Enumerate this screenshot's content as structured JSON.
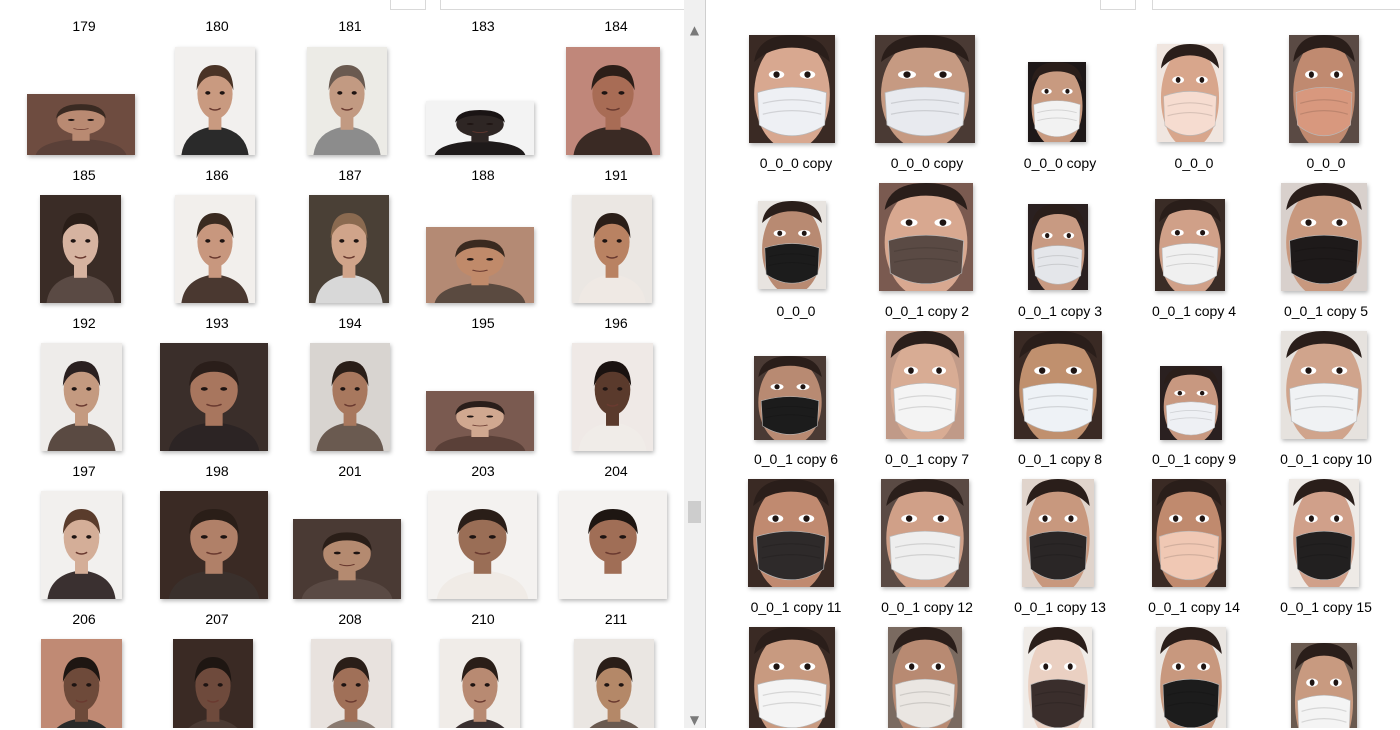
{
  "left_pane": {
    "top_labels": [
      "179",
      "180",
      "181",
      "183",
      "184"
    ],
    "items": [
      {
        "label": "185",
        "bg": "#6e4c40",
        "skin": "#b98a72",
        "hair": "#3a2a22",
        "shirt": "#5a4038"
      },
      {
        "label": "186",
        "bg": "#f2f0ee",
        "skin": "#c99a80",
        "hair": "#4a3326",
        "shirt": "#2a2a2a"
      },
      {
        "label": "187",
        "bg": "#ecebe6",
        "skin": "#c29a82",
        "hair": "#6a5a50",
        "shirt": "#8c8c8c"
      },
      {
        "label": "188",
        "bg": "#f3f3f3",
        "skin": "#2e2624",
        "hair": "#1a1414",
        "shirt": "#1e1a1a"
      },
      {
        "label": "191",
        "bg": "#c0877a",
        "skin": "#a86c55",
        "hair": "#2c1e18",
        "shirt": "#3a2a24"
      },
      {
        "label": "192",
        "bg": "#3a2c26",
        "skin": "#d6b3a0",
        "hair": "#2a1e18",
        "shirt": "#5a4a44"
      },
      {
        "label": "193",
        "bg": "#f2efec",
        "skin": "#c8977e",
        "hair": "#3a2a20",
        "shirt": "#4a3830"
      },
      {
        "label": "194",
        "bg": "#4a4036",
        "skin": "#d0a48a",
        "hair": "#8a6a50",
        "shirt": "#d8d8d8"
      },
      {
        "label": "195",
        "bg": "#b48a74",
        "skin": "#c08a6a",
        "hair": "#3a2a20",
        "shirt": "#5a4a40"
      },
      {
        "label": "196",
        "bg": "#ebe7e3",
        "skin": "#b98262",
        "hair": "#2a1e18",
        "shirt": "#efe9e4"
      },
      {
        "label": "197",
        "bg": "#eeecea",
        "skin": "#c49a80",
        "hair": "#2a2020",
        "shirt": "#5a4a42"
      },
      {
        "label": "198",
        "bg": "#3a2e2a",
        "skin": "#a8765e",
        "hair": "#2a1e1a",
        "shirt": "#2c2424"
      },
      {
        "label": "201",
        "bg": "#d8d4d0",
        "skin": "#a8785e",
        "hair": "#2a1e18",
        "shirt": "#6a5a50"
      },
      {
        "label": "203",
        "bg": "#7a5a50",
        "skin": "#d0a890",
        "hair": "#2a1e1a",
        "shirt": "#5a4038"
      },
      {
        "label": "204",
        "bg": "#efe9e6",
        "skin": "#5a3a2c",
        "hair": "#1a1210",
        "shirt": "#f0ece8"
      },
      {
        "label": "206",
        "bg": "#f2f0ee",
        "skin": "#d4ae98",
        "hair": "#5a3c2c",
        "shirt": "#3a3030"
      },
      {
        "label": "207",
        "bg": "#3a2a24",
        "skin": "#b08068",
        "hair": "#2a1e18",
        "shirt": "#3a302c"
      },
      {
        "label": "208",
        "bg": "#4a3a34",
        "skin": "#b48a70",
        "hair": "#2a1e18",
        "shirt": "#5a4a44"
      },
      {
        "label": "210",
        "bg": "#f4f2f0",
        "skin": "#9a6e56",
        "hair": "#2a1e18",
        "shirt": "#f0ebe6"
      },
      {
        "label": "211",
        "bg": "#f4f2f0",
        "skin": "#a06e56",
        "hair": "#1e1612",
        "shirt": "#f4f2f0"
      },
      {
        "label": "",
        "bg": "#c08a74",
        "skin": "#6e4a3a",
        "hair": "#1e1612",
        "shirt": "#2a2a2a"
      },
      {
        "label": "",
        "bg": "#3a2a24",
        "skin": "#6e4a3c",
        "hair": "#1e1612",
        "shirt": "#4a3a34"
      },
      {
        "label": "",
        "bg": "#e8e2de",
        "skin": "#a07058",
        "hair": "#2a1e18",
        "shirt": "#8a7a70"
      },
      {
        "label": "",
        "bg": "#f0ece8",
        "skin": "#b88a72",
        "hair": "#2a1e18",
        "shirt": "#3a3030"
      },
      {
        "label": "",
        "bg": "#eae6e2",
        "skin": "#b48868",
        "hair": "#2a1e18",
        "shirt": "#6a5a50"
      }
    ]
  },
  "right_pane": {
    "items": [
      {
        "label": "0_0_0 copy",
        "skin": "#d8a890",
        "mask": "#eef0f4",
        "bg": "#3a2a24"
      },
      {
        "label": "0_0_0 copy",
        "skin": "#c69a82",
        "mask": "#e8eaef",
        "bg": "#4a3a34"
      },
      {
        "label": "0_0_0 copy",
        "skin": "#c89a80",
        "mask": "#f2f2f2",
        "bg": "#1e1818"
      },
      {
        "label": "0_0_0",
        "skin": "#d8a68c",
        "mask": "#f6dcd0",
        "bg": "#f0e6e0"
      },
      {
        "label": "0_0_0",
        "skin": "#c08a70",
        "mask": "#d8987e",
        "bg": "#5a4a44"
      },
      {
        "label": "0_0_0",
        "skin": "#b88a72",
        "mask": "#1c1c1c",
        "bg": "#e8e4e0"
      },
      {
        "label": "0_0_1 copy 2",
        "skin": "#d8a890",
        "mask": "#5a4a44",
        "bg": "#7a5a50"
      },
      {
        "label": "0_0_1 copy 3",
        "skin": "#c89a82",
        "mask": "#e4e6ea",
        "bg": "#2a2020"
      },
      {
        "label": "0_0_1 copy 4",
        "skin": "#d0a088",
        "mask": "#f0f0f0",
        "bg": "#3a2c26"
      },
      {
        "label": "0_0_1 copy 5",
        "skin": "#c8987e",
        "mask": "#1e1a1a",
        "bg": "#d8d0cc"
      },
      {
        "label": "0_0_1 copy 6",
        "skin": "#b88a72",
        "mask": "#1c1c1c",
        "bg": "#4a3a34"
      },
      {
        "label": "0_0_1 copy 7",
        "skin": "#d8ac94",
        "mask": "#f4f4f4",
        "bg": "#c09a88"
      },
      {
        "label": "0_0_1 copy 8",
        "skin": "#c0906e",
        "mask": "#eef2f6",
        "bg": "#3a2a24"
      },
      {
        "label": "0_0_1 copy 9",
        "skin": "#c89880",
        "mask": "#eef0f4",
        "bg": "#2a2020"
      },
      {
        "label": "0_0_1 copy 10",
        "skin": "#d0a48c",
        "mask": "#f0f2f4",
        "bg": "#e6e2de"
      },
      {
        "label": "0_0_1 copy 11",
        "skin": "#c08a70",
        "mask": "#2e2a2a",
        "bg": "#3a2a24"
      },
      {
        "label": "0_0_1 copy 12",
        "skin": "#d0a088",
        "mask": "#eeeeee",
        "bg": "#5a4a44"
      },
      {
        "label": "0_0_1 copy 13",
        "skin": "#c8987e",
        "mask": "#2a2626",
        "bg": "#e0d4cc"
      },
      {
        "label": "0_0_1 copy 14",
        "skin": "#c08a6e",
        "mask": "#f0c8b4",
        "bg": "#3a2a24"
      },
      {
        "label": "0_0_1 copy 15",
        "skin": "#d0a08a",
        "mask": "#222020",
        "bg": "#eeeae6"
      },
      {
        "label": "",
        "skin": "#c89a80",
        "mask": "#f4f4f4",
        "bg": "#3a2a24"
      },
      {
        "label": "",
        "skin": "#b88a72",
        "mask": "#eae6e2",
        "bg": "#7a6a60"
      },
      {
        "label": "",
        "skin": "#ead0c2",
        "mask": "#3a2e2c",
        "bg": "#f0ece8"
      },
      {
        "label": "",
        "skin": "#c8987e",
        "mask": "#1c1c1c",
        "bg": "#eae6e2"
      },
      {
        "label": "",
        "skin": "#c89a80",
        "mask": "#f4f4f4",
        "bg": "#6a5a50"
      }
    ]
  },
  "icons": {
    "scroll_up": "chevron-up-icon",
    "scroll_down": "chevron-down-icon"
  }
}
